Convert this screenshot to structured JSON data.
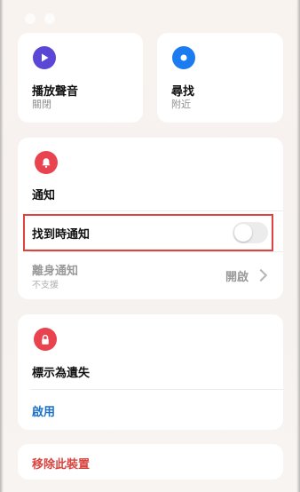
{
  "play_sound": {
    "title": "播放聲音",
    "status": "關閉",
    "icon": "play-icon",
    "icon_color": "#5b47d6"
  },
  "find": {
    "title": "尋找",
    "status": "附近",
    "icon": "locate-icon",
    "icon_color": "#1a7cf0"
  },
  "notifications": {
    "title": "通知",
    "icon": "bell-icon",
    "icon_color": "#e8434f",
    "notify_when_found": {
      "label": "找到時通知",
      "enabled": false
    },
    "notify_when_left_behind": {
      "label": "離身通知",
      "sub": "不支援",
      "value": "開啟"
    }
  },
  "lost_mode": {
    "title": "標示為遺失",
    "icon": "lock-icon",
    "icon_color": "#e8434f",
    "action": "啟用"
  },
  "remove": {
    "label": "移除此裝置"
  }
}
